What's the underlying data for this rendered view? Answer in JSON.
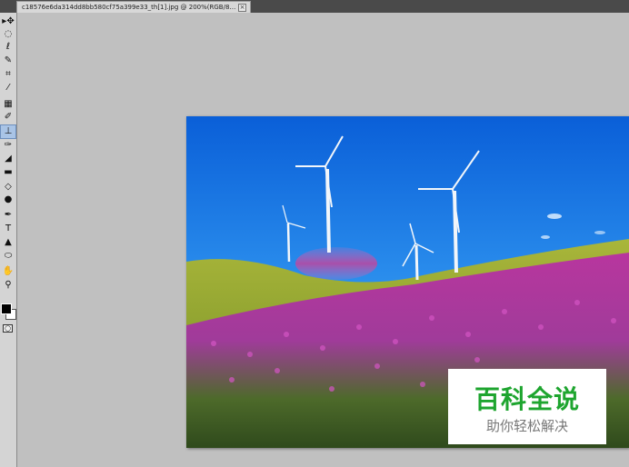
{
  "document": {
    "tab_title": "c18576e6da314dd8bb580cf75a399e33_th[1].jpg @ 200%(RGB/8) *",
    "close_glyph": "×"
  },
  "toolbox": {
    "tools": [
      {
        "name": "move-tool-icon",
        "glyph": "▸✥"
      },
      {
        "name": "marquee-tool-icon",
        "glyph": "◌"
      },
      {
        "name": "lasso-tool-icon",
        "glyph": "ℓ"
      },
      {
        "name": "quick-selection-tool-icon",
        "glyph": "✎"
      },
      {
        "name": "crop-tool-icon",
        "glyph": "⌗"
      },
      {
        "name": "eyedropper-tool-icon",
        "glyph": "⁄"
      },
      {
        "name": "healing-brush-tool-icon",
        "glyph": "▦"
      },
      {
        "name": "brush-tool-icon",
        "glyph": "✐"
      },
      {
        "name": "clone-stamp-tool-icon",
        "glyph": "⊥",
        "selected": true
      },
      {
        "name": "history-brush-tool-icon",
        "glyph": "✑"
      },
      {
        "name": "eraser-tool-icon",
        "glyph": "◢"
      },
      {
        "name": "gradient-tool-icon",
        "glyph": "▬"
      },
      {
        "name": "blur-tool-icon",
        "glyph": "◇"
      },
      {
        "name": "dodge-tool-icon",
        "glyph": "●"
      },
      {
        "name": "pen-tool-icon",
        "glyph": "✒"
      },
      {
        "name": "type-tool-icon",
        "glyph": "T"
      },
      {
        "name": "path-selection-tool-icon",
        "glyph": "▲"
      },
      {
        "name": "shape-tool-icon",
        "glyph": "⬭"
      },
      {
        "name": "hand-tool-icon",
        "glyph": "✋"
      },
      {
        "name": "zoom-tool-icon",
        "glyph": "⚲"
      }
    ],
    "foreground_color": "#000000",
    "background_color": "#ffffff"
  },
  "watermark": {
    "title": "百科全说",
    "subtitle": "助你轻松解决",
    "title_color": "#1ea52f"
  }
}
